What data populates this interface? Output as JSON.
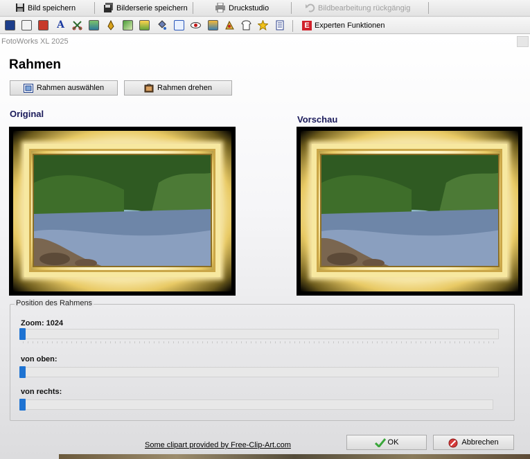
{
  "toolbar_top": {
    "save_image": "Bild speichern",
    "save_series": "Bilderserie speichern",
    "print_studio": "Druckstudio",
    "undo_edit": "Bildbearbeitung rückgängig"
  },
  "toolbar_tools": {
    "expert_label": "Experten Funktionen",
    "expert_badge": "E",
    "accent": "#d0202a"
  },
  "dialog": {
    "caption": "FotoWorks XL 2025",
    "title": "Rahmen",
    "select_frame_button": "Rahmen auswählen",
    "rotate_frame_button": "Rahmen drehen",
    "original_label": "Original",
    "preview_label": "Vorschau",
    "position_group": "Position des Rahmens",
    "zoom_label": "Zoom: 1024",
    "from_top_label": "von oben:",
    "from_right_label": "von rechts:",
    "clipart_link": "Some clipart provided by Free-Clip-Art.com",
    "ok_button": "OK",
    "cancel_button": "Abbrechen"
  },
  "sliders": {
    "zoom_level": 0,
    "from_top_level": 0,
    "from_right_level": 0,
    "thumb_color": "#1e73d2"
  }
}
